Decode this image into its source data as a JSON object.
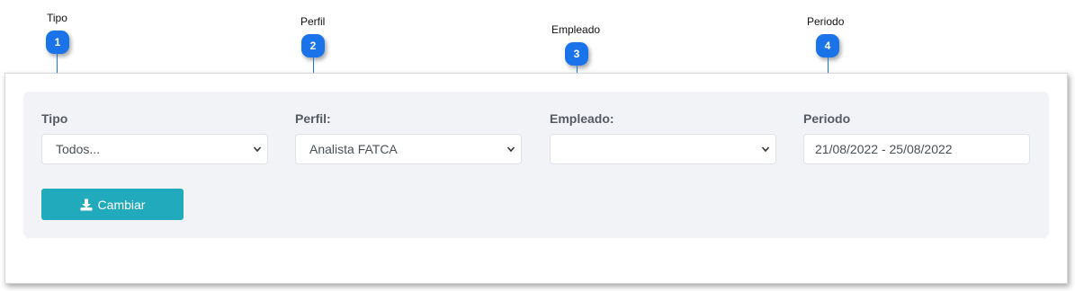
{
  "callouts": [
    {
      "label": "Tipo",
      "number": "1"
    },
    {
      "label": "Perfil",
      "number": "2"
    },
    {
      "label": "Empleado",
      "number": "3"
    },
    {
      "label": "Periodo",
      "number": "4"
    }
  ],
  "filters": {
    "tipo": {
      "label": "Tipo",
      "value": "Todos..."
    },
    "perfil": {
      "label": "Perfil:",
      "value": "Analista FATCA"
    },
    "empleado": {
      "label": "Empleado:",
      "value": ""
    },
    "periodo": {
      "label": "Periodo",
      "value": "21/08/2022 - 25/08/2022"
    }
  },
  "actions": {
    "change_label": "Cambiar",
    "change_icon": "download-icon"
  },
  "colors": {
    "badge": "#1a73e8",
    "button": "#20aabb",
    "panel": "#f2f3f7"
  }
}
